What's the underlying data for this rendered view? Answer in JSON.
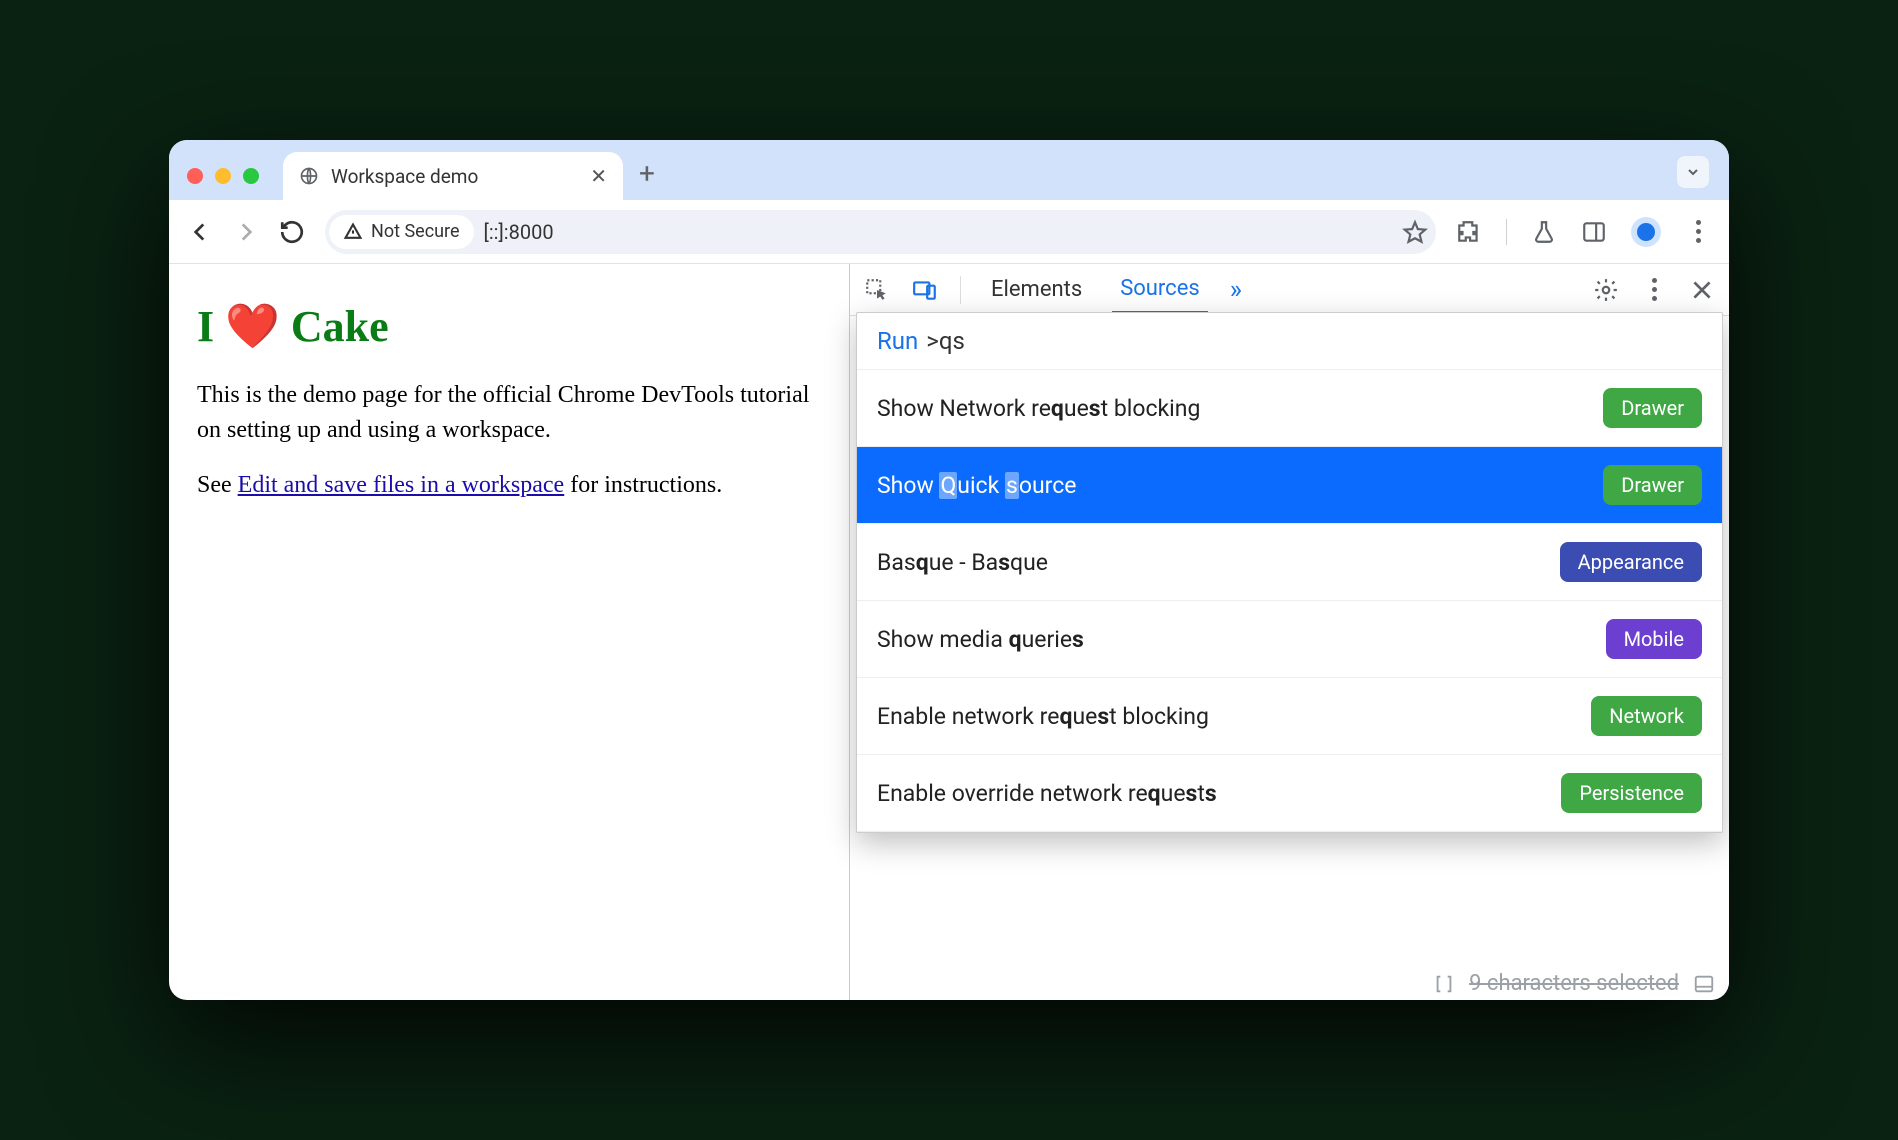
{
  "tab": {
    "title": "Workspace demo"
  },
  "toolbar": {
    "secure_label": "Not Secure",
    "url": "[::]:8000"
  },
  "page": {
    "heading": "I ❤️ Cake",
    "para1": "This is the demo page for the official Chrome DevTools tutorial on setting up and using a workspace.",
    "see_prefix": "See ",
    "link_text": "Edit and save files in a workspace",
    "see_suffix": " for instructions."
  },
  "devtools": {
    "tabs": {
      "elements": "Elements",
      "sources": "Sources"
    },
    "cmd": {
      "run_label": "Run",
      "query": ">qs",
      "items": [
        {
          "html": "Show Network re<b>q</b>ue<b>s</b>t blocking",
          "badge": "Drawer",
          "badge_class": "drawer",
          "selected": false
        },
        {
          "html": "Show <span class='hl'>Q</span>uick <span class='hl'>s</span>ource",
          "badge": "Drawer",
          "badge_class": "drawer",
          "selected": true
        },
        {
          "html": "Bas<b>q</b>ue - Ba<b>s</b>que",
          "badge": "Appearance",
          "badge_class": "appearance",
          "selected": false
        },
        {
          "html": "Show media <b>q</b>uerie<b>s</b>",
          "badge": "Mobile",
          "badge_class": "mobile",
          "selected": false
        },
        {
          "html": "Enable network re<b>q</b>ue<b>s</b>t blocking",
          "badge": "Network",
          "badge_class": "network",
          "selected": false
        },
        {
          "html": "Enable override network re<b>q</b>ue<b>s</b>t<b>s</b>",
          "badge": "Persistence",
          "badge_class": "persistence",
          "selected": false
        }
      ]
    },
    "status": "9 characters selected"
  }
}
